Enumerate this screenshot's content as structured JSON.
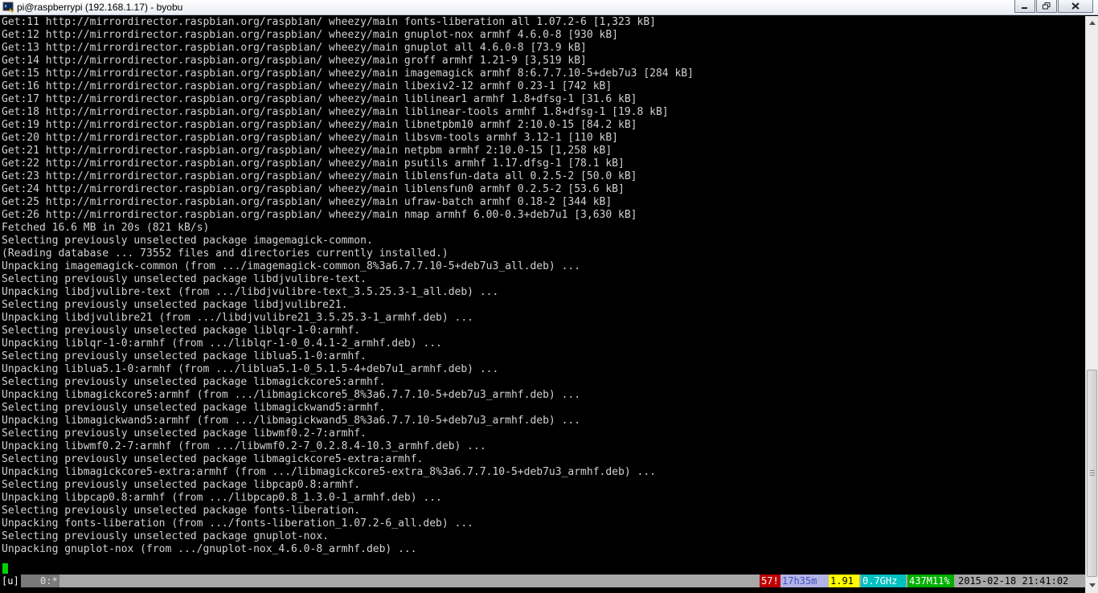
{
  "window": {
    "title": "pi@raspberrypi (192.168.1.17) - byobu"
  },
  "terminal": {
    "lines": [
      "Get:11 http://mirrordirector.raspbian.org/raspbian/ wheezy/main fonts-liberation all 1.07.2-6 [1,323 kB]",
      "Get:12 http://mirrordirector.raspbian.org/raspbian/ wheezy/main gnuplot-nox armhf 4.6.0-8 [930 kB]",
      "Get:13 http://mirrordirector.raspbian.org/raspbian/ wheezy/main gnuplot all 4.6.0-8 [73.9 kB]",
      "Get:14 http://mirrordirector.raspbian.org/raspbian/ wheezy/main groff armhf 1.21-9 [3,519 kB]",
      "Get:15 http://mirrordirector.raspbian.org/raspbian/ wheezy/main imagemagick armhf 8:6.7.7.10-5+deb7u3 [284 kB]",
      "Get:16 http://mirrordirector.raspbian.org/raspbian/ wheezy/main libexiv2-12 armhf 0.23-1 [742 kB]",
      "Get:17 http://mirrordirector.raspbian.org/raspbian/ wheezy/main liblinear1 armhf 1.8+dfsg-1 [31.6 kB]",
      "Get:18 http://mirrordirector.raspbian.org/raspbian/ wheezy/main liblinear-tools armhf 1.8+dfsg-1 [19.8 kB]",
      "Get:19 http://mirrordirector.raspbian.org/raspbian/ wheezy/main libnetpbm10 armhf 2:10.0-15 [84.2 kB]",
      "Get:20 http://mirrordirector.raspbian.org/raspbian/ wheezy/main libsvm-tools armhf 3.12-1 [110 kB]",
      "Get:21 http://mirrordirector.raspbian.org/raspbian/ wheezy/main netpbm armhf 2:10.0-15 [1,258 kB]",
      "Get:22 http://mirrordirector.raspbian.org/raspbian/ wheezy/main psutils armhf 1.17.dfsg-1 [78.1 kB]",
      "Get:23 http://mirrordirector.raspbian.org/raspbian/ wheezy/main liblensfun-data all 0.2.5-2 [50.0 kB]",
      "Get:24 http://mirrordirector.raspbian.org/raspbian/ wheezy/main liblensfun0 armhf 0.2.5-2 [53.6 kB]",
      "Get:25 http://mirrordirector.raspbian.org/raspbian/ wheezy/main ufraw-batch armhf 0.18-2 [344 kB]",
      "Get:26 http://mirrordirector.raspbian.org/raspbian/ wheezy/main nmap armhf 6.00-0.3+deb7u1 [3,630 kB]",
      "Fetched 16.6 MB in 20s (821 kB/s)",
      "Selecting previously unselected package imagemagick-common.",
      "(Reading database ... 73552 files and directories currently installed.)",
      "Unpacking imagemagick-common (from .../imagemagick-common_8%3a6.7.7.10-5+deb7u3_all.deb) ...",
      "Selecting previously unselected package libdjvulibre-text.",
      "Unpacking libdjvulibre-text (from .../libdjvulibre-text_3.5.25.3-1_all.deb) ...",
      "Selecting previously unselected package libdjvulibre21.",
      "Unpacking libdjvulibre21 (from .../libdjvulibre21_3.5.25.3-1_armhf.deb) ...",
      "Selecting previously unselected package liblqr-1-0:armhf.",
      "Unpacking liblqr-1-0:armhf (from .../liblqr-1-0_0.4.1-2_armhf.deb) ...",
      "Selecting previously unselected package liblua5.1-0:armhf.",
      "Unpacking liblua5.1-0:armhf (from .../liblua5.1-0_5.1.5-4+deb7u1_armhf.deb) ...",
      "Selecting previously unselected package libmagickcore5:armhf.",
      "Unpacking libmagickcore5:armhf (from .../libmagickcore5_8%3a6.7.7.10-5+deb7u3_armhf.deb) ...",
      "Selecting previously unselected package libmagickwand5:armhf.",
      "Unpacking libmagickwand5:armhf (from .../libmagickwand5_8%3a6.7.7.10-5+deb7u3_armhf.deb) ...",
      "Selecting previously unselected package libwmf0.2-7:armhf.",
      "Unpacking libwmf0.2-7:armhf (from .../libwmf0.2-7_0.2.8.4-10.3_armhf.deb) ...",
      "Selecting previously unselected package libmagickcore5-extra:armhf.",
      "Unpacking libmagickcore5-extra:armhf (from .../libmagickcore5-extra_8%3a6.7.7.10-5+deb7u3_armhf.deb) ...",
      "Selecting previously unselected package libpcap0.8:armhf.",
      "Unpacking libpcap0.8:armhf (from .../libpcap0.8_1.3.0-1_armhf.deb) ...",
      "Selecting previously unselected package fonts-liberation.",
      "Unpacking fonts-liberation (from .../fonts-liberation_1.07.2-6_all.deb) ...",
      "Selecting previously unselected package gnuplot-nox.",
      "Unpacking gnuplot-nox (from .../gnuplot-nox_4.6.0-8_armhf.deb) ..."
    ]
  },
  "statusbar": {
    "session_label": "[u]",
    "window_label": "0:*",
    "updates": "57!",
    "uptime": "17h35m",
    "load": "1.91",
    "cpu_freq": "0.7GHz",
    "memory": "437M11%",
    "datetime": "2015-02-18 21:41:02",
    "colors": {
      "bar_bg": "#a8a8a8",
      "updates_bg": "#c00000",
      "uptime_bg": "#b3b3e6",
      "load_bg": "#ffff00",
      "cpu_bg": "#00c0c0",
      "memory_bg": "#00b000"
    }
  }
}
